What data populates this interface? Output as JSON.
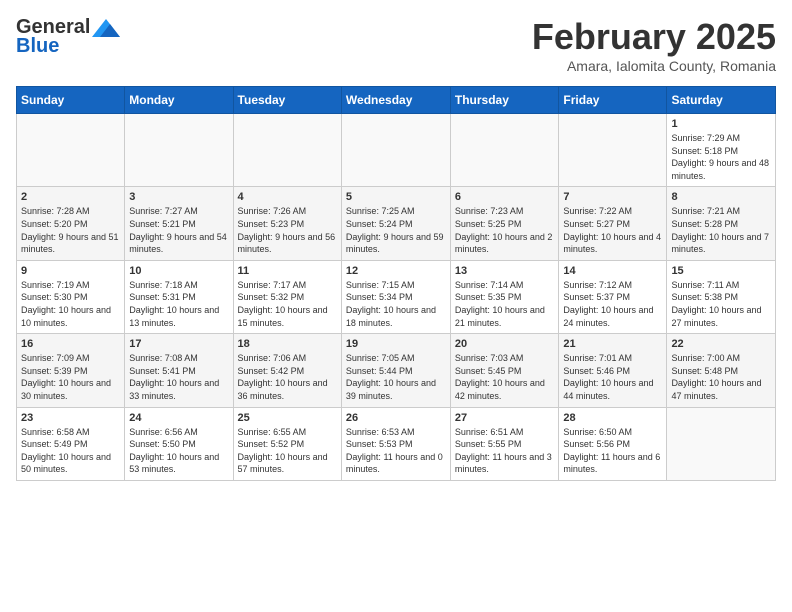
{
  "header": {
    "logo": {
      "general": "General",
      "blue": "Blue"
    },
    "title": "February 2025",
    "location": "Amara, Ialomita County, Romania"
  },
  "days_of_week": [
    "Sunday",
    "Monday",
    "Tuesday",
    "Wednesday",
    "Thursday",
    "Friday",
    "Saturday"
  ],
  "weeks": [
    [
      {
        "day": "",
        "info": ""
      },
      {
        "day": "",
        "info": ""
      },
      {
        "day": "",
        "info": ""
      },
      {
        "day": "",
        "info": ""
      },
      {
        "day": "",
        "info": ""
      },
      {
        "day": "",
        "info": ""
      },
      {
        "day": "1",
        "info": "Sunrise: 7:29 AM\nSunset: 5:18 PM\nDaylight: 9 hours and 48 minutes."
      }
    ],
    [
      {
        "day": "2",
        "info": "Sunrise: 7:28 AM\nSunset: 5:20 PM\nDaylight: 9 hours and 51 minutes."
      },
      {
        "day": "3",
        "info": "Sunrise: 7:27 AM\nSunset: 5:21 PM\nDaylight: 9 hours and 54 minutes."
      },
      {
        "day": "4",
        "info": "Sunrise: 7:26 AM\nSunset: 5:23 PM\nDaylight: 9 hours and 56 minutes."
      },
      {
        "day": "5",
        "info": "Sunrise: 7:25 AM\nSunset: 5:24 PM\nDaylight: 9 hours and 59 minutes."
      },
      {
        "day": "6",
        "info": "Sunrise: 7:23 AM\nSunset: 5:25 PM\nDaylight: 10 hours and 2 minutes."
      },
      {
        "day": "7",
        "info": "Sunrise: 7:22 AM\nSunset: 5:27 PM\nDaylight: 10 hours and 4 minutes."
      },
      {
        "day": "8",
        "info": "Sunrise: 7:21 AM\nSunset: 5:28 PM\nDaylight: 10 hours and 7 minutes."
      }
    ],
    [
      {
        "day": "9",
        "info": "Sunrise: 7:19 AM\nSunset: 5:30 PM\nDaylight: 10 hours and 10 minutes."
      },
      {
        "day": "10",
        "info": "Sunrise: 7:18 AM\nSunset: 5:31 PM\nDaylight: 10 hours and 13 minutes."
      },
      {
        "day": "11",
        "info": "Sunrise: 7:17 AM\nSunset: 5:32 PM\nDaylight: 10 hours and 15 minutes."
      },
      {
        "day": "12",
        "info": "Sunrise: 7:15 AM\nSunset: 5:34 PM\nDaylight: 10 hours and 18 minutes."
      },
      {
        "day": "13",
        "info": "Sunrise: 7:14 AM\nSunset: 5:35 PM\nDaylight: 10 hours and 21 minutes."
      },
      {
        "day": "14",
        "info": "Sunrise: 7:12 AM\nSunset: 5:37 PM\nDaylight: 10 hours and 24 minutes."
      },
      {
        "day": "15",
        "info": "Sunrise: 7:11 AM\nSunset: 5:38 PM\nDaylight: 10 hours and 27 minutes."
      }
    ],
    [
      {
        "day": "16",
        "info": "Sunrise: 7:09 AM\nSunset: 5:39 PM\nDaylight: 10 hours and 30 minutes."
      },
      {
        "day": "17",
        "info": "Sunrise: 7:08 AM\nSunset: 5:41 PM\nDaylight: 10 hours and 33 minutes."
      },
      {
        "day": "18",
        "info": "Sunrise: 7:06 AM\nSunset: 5:42 PM\nDaylight: 10 hours and 36 minutes."
      },
      {
        "day": "19",
        "info": "Sunrise: 7:05 AM\nSunset: 5:44 PM\nDaylight: 10 hours and 39 minutes."
      },
      {
        "day": "20",
        "info": "Sunrise: 7:03 AM\nSunset: 5:45 PM\nDaylight: 10 hours and 42 minutes."
      },
      {
        "day": "21",
        "info": "Sunrise: 7:01 AM\nSunset: 5:46 PM\nDaylight: 10 hours and 44 minutes."
      },
      {
        "day": "22",
        "info": "Sunrise: 7:00 AM\nSunset: 5:48 PM\nDaylight: 10 hours and 47 minutes."
      }
    ],
    [
      {
        "day": "23",
        "info": "Sunrise: 6:58 AM\nSunset: 5:49 PM\nDaylight: 10 hours and 50 minutes."
      },
      {
        "day": "24",
        "info": "Sunrise: 6:56 AM\nSunset: 5:50 PM\nDaylight: 10 hours and 53 minutes."
      },
      {
        "day": "25",
        "info": "Sunrise: 6:55 AM\nSunset: 5:52 PM\nDaylight: 10 hours and 57 minutes."
      },
      {
        "day": "26",
        "info": "Sunrise: 6:53 AM\nSunset: 5:53 PM\nDaylight: 11 hours and 0 minutes."
      },
      {
        "day": "27",
        "info": "Sunrise: 6:51 AM\nSunset: 5:55 PM\nDaylight: 11 hours and 3 minutes."
      },
      {
        "day": "28",
        "info": "Sunrise: 6:50 AM\nSunset: 5:56 PM\nDaylight: 11 hours and 6 minutes."
      },
      {
        "day": "",
        "info": ""
      }
    ]
  ]
}
